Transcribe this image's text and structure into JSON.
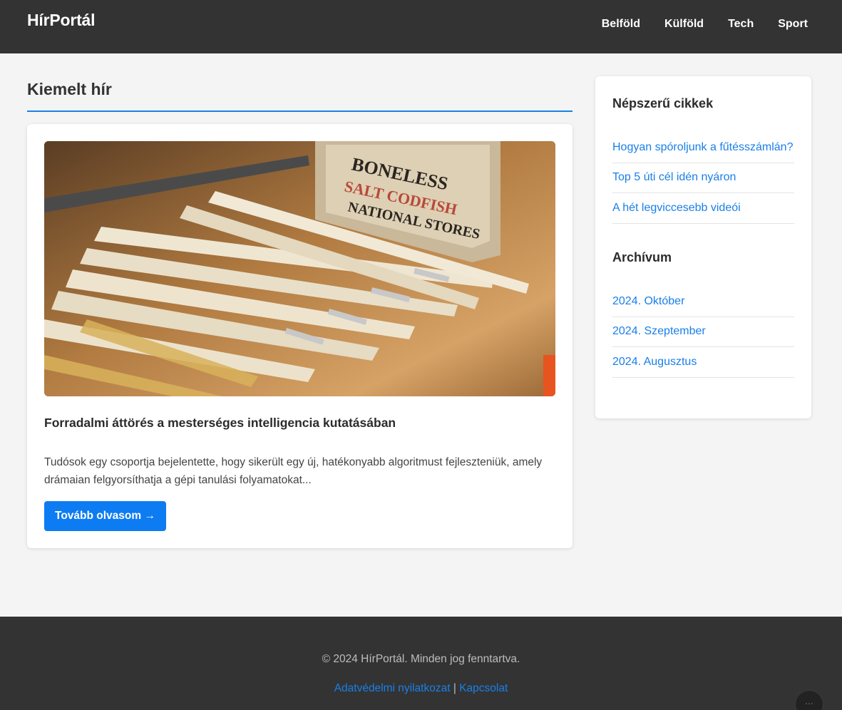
{
  "header": {
    "logo": "HírPortál",
    "nav": [
      "Belföld",
      "Külföld",
      "Tech",
      "Sport"
    ]
  },
  "main": {
    "section_title": "Kiemelt hír",
    "article": {
      "image_alt": "close-up of wooden folding rulers with stamped crate",
      "title": "Forradalmi áttörés a mesterséges intelligencia kutatásában",
      "excerpt": "Tudósok egy csoportja bejelentette, hogy sikerült egy új, hatékonyabb algoritmust fejleszteniük, amely drámaian felgyorsíthatja a gépi tanulási folyamatokat...",
      "read_more": "Tovább olvasom →"
    }
  },
  "sidebar": {
    "popular_heading": "Népszerű cikkek",
    "popular": [
      "Hogyan spóroljunk a fűtésszámlán?",
      "Top 5 úti cél idén nyáron",
      "A hét legviccesebb videói"
    ],
    "archive_heading": "Archívum",
    "archive": [
      "2024. Október",
      "2024. Szeptember",
      "2024. Augusztus"
    ]
  },
  "footer": {
    "copyright": "© 2024 HírPortál. Minden jog fenntartva.",
    "privacy": "Adatvédelmi nyilatkozat",
    "separator": "|",
    "contact": "Kapcsolat"
  },
  "colors": {
    "header_bg": "#333333",
    "accent": "#1a7fe8",
    "button": "#0d7cf2",
    "page_bg": "#f4f4f4"
  },
  "icons": {
    "floating": "grid-dots-icon"
  }
}
